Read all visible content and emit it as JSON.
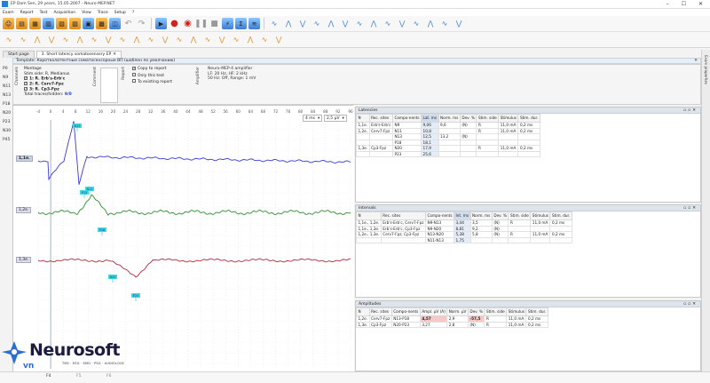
{
  "window": {
    "title": "EP Dom Sen, 29 years, 15.05.2007 - Neuro-MEP.NET",
    "controls": [
      "–",
      "☐",
      "✕"
    ]
  },
  "menu": [
    "Exam",
    "Report",
    "Test",
    "Acquisition",
    "View",
    "Trace",
    "Setup",
    "?"
  ],
  "tabs": [
    {
      "label": "Start page",
      "active": false
    },
    {
      "label": "3. Short latency somatosensory EP",
      "active": true
    }
  ],
  "template": "Template: Коротколатентные соматосенсорные ВП (шаблон по умолчанию)",
  "right_strip_label": "Exam properties",
  "left_labels": [
    "P0",
    "N9",
    "N11",
    "N13",
    "P18",
    "N20",
    "P23",
    "N30",
    "P45"
  ],
  "settings": {
    "channels_label": "Channels",
    "montage_title": "Montage",
    "stim_side": "Stim side: R, Medianus",
    "channels": [
      {
        "label": "1: R. Erb's-Erb'c"
      },
      {
        "label": "2: R. Cerv7-Fpz"
      },
      {
        "label": "3: R. Cp3-Fpz"
      }
    ],
    "total_traces_label": "Total traces/hidden:",
    "total_traces_value": "9/0",
    "comment_label": "Comment",
    "report_label": "Report",
    "report_options": [
      {
        "label": "Copy to report",
        "checked": true
      },
      {
        "label": "Only this test",
        "checked": false
      },
      {
        "label": "To existing report",
        "checked": false
      }
    ],
    "amplifier_label": "Amplifier",
    "amplifier_lines": [
      "Neuro-MEP-4 amplifier",
      "LF: 20 Hz, HF: 2 kHz",
      "50 Hz: Off, Range: 1 mV"
    ]
  },
  "chart": {
    "timescale": "4 ms",
    "sensitivity": "2,5 µV",
    "time_ticks": [
      "-4",
      "0",
      "4",
      "8",
      "12",
      "16",
      "20",
      "24",
      "28",
      "32",
      "36",
      "40",
      "44",
      "48",
      "52",
      "56",
      "60",
      "64",
      "68",
      "72",
      "76",
      "80",
      "84",
      "88",
      "92",
      "96"
    ],
    "traces": [
      {
        "label": "1,1e.",
        "color": "#3a3ad6",
        "selected": true
      },
      {
        "label": "1,2e.",
        "color": "#2f8f2f",
        "selected": false
      },
      {
        "label": "1,3e.",
        "color": "#b02a3a",
        "selected": false
      }
    ],
    "markers": [
      "N13",
      "P13",
      "N11",
      "P18",
      "N20",
      "P23"
    ],
    "colors": {
      "marker": "#3fd6e8"
    }
  },
  "latencies": {
    "title": "Latencies",
    "columns": [
      "N",
      "Rec. sites",
      "Compo-nents",
      "Lat. ms",
      "Norm. ms",
      "Dev. %",
      "Stim. side",
      "Stimulus",
      "Stim. dur."
    ],
    "rows": [
      [
        "1,1e.",
        "Erb's-Erb'c",
        "N9",
        "9,06",
        "9,6",
        "(N)",
        "R",
        "11,0 mA",
        "0,2 ms"
      ],
      [
        "1,2e.",
        "Cerv7-Fpz",
        "N11",
        "10,8",
        "",
        "",
        "R",
        "11,0 mA",
        "0,2 ms"
      ],
      [
        "",
        "",
        "N13",
        "12,5",
        "13,2",
        "(N)",
        "",
        "",
        ""
      ],
      [
        "",
        "",
        "P18",
        "18,1",
        "",
        "",
        "",
        "",
        ""
      ],
      [
        "1,3e.",
        "Cp3-Fpz",
        "N20",
        "17,9",
        "",
        "",
        "R",
        "11,0 mA",
        "0,2 ms"
      ],
      [
        "",
        "",
        "P23",
        "25,6",
        "",
        "",
        "",
        "",
        ""
      ]
    ]
  },
  "intervals": {
    "title": "Intervals",
    "columns": [
      "N",
      "Rec. sites",
      "Compo-nents",
      "Int. ms",
      "Norm. ms",
      "Dev. %",
      "Stim. side",
      "Stimulus",
      "Stim. dur."
    ],
    "rows": [
      [
        "1,1e., 1,2e.",
        "Erb's-Erb'c, Cerv7-Fpz",
        "N9-N13",
        "3,44",
        "3,5",
        "(N)",
        "R",
        "11,0 mA",
        "0,2 ms"
      ],
      [
        "1,1e., 1,3e.",
        "Erb's-Erb'c, Cp3-Fpz",
        "N9-N20",
        "8,81",
        "9,2",
        "(N)",
        "",
        "",
        ""
      ],
      [
        "1,2e., 1,3e.",
        "Cerv7-Fpz, Cp3-Fpz",
        "N13-N20",
        "5,38",
        "5,8",
        "(N)",
        "R",
        "11,0 mA",
        "0,2 ms"
      ],
      [
        "",
        "",
        "N11-N13",
        "1,75",
        "",
        "",
        "",
        "",
        ""
      ]
    ]
  },
  "amplitudes": {
    "title": "Amplitudes",
    "columns": [
      "N",
      "Rec. sites",
      "Compo-nents",
      "Ampl. µV (A)",
      "Norm. µV",
      "Dev. %",
      "Stim. side",
      "Stimulus",
      "Stim. dur."
    ],
    "rows": [
      [
        "1,2e.",
        "Cerv7-Fpz",
        "N13-P18",
        "4,57",
        "2,9",
        "-57,5",
        "R",
        "11,0 mA",
        "0,2 ms"
      ],
      [
        "1,3e.",
        "Cp3-Fpz",
        "N20-P23",
        "3,27",
        "2,8",
        "(N)",
        "R",
        "11,0 mA",
        "0,2 ms"
      ]
    ]
  },
  "logo": {
    "name": "Neurosoft",
    "suffix": "vn",
    "tagline": "TMS · EEG · EMG · PSG · AUDIOLOGY"
  },
  "function_keys": [
    {
      "label": "F4",
      "enabled": true
    },
    {
      "label": "F5",
      "enabled": false
    },
    {
      "label": "F6",
      "enabled": false
    }
  ]
}
